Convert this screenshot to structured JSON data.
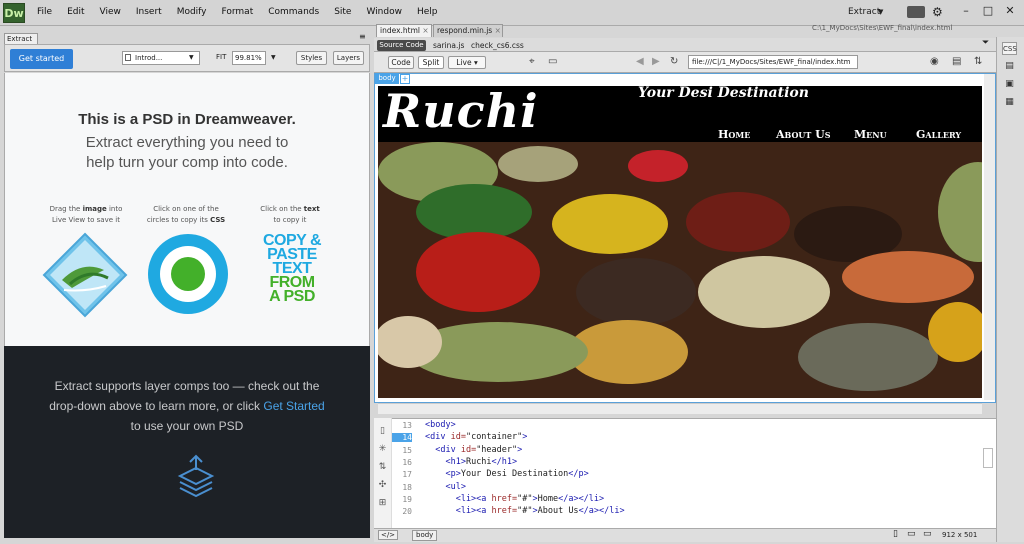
{
  "app": {
    "logo": "Dw",
    "menus": [
      "File",
      "Edit",
      "View",
      "Insert",
      "Modify",
      "Format",
      "Commands",
      "Site",
      "Window",
      "Help"
    ],
    "workspace": "Extract"
  },
  "extract": {
    "tab": "Extract",
    "get_started": "Get started",
    "select_value": "Introd...",
    "fit": "FIT",
    "zoom": "99.81%",
    "styles": "Styles",
    "layers": "Layers",
    "title": "This is a PSD in Dreamweaver.",
    "subtitle_1": "Extract everything you need to",
    "subtitle_2": "help turn your comp into code.",
    "col1_a": "Drag the ",
    "col1_b": "image",
    "col1_c": " into",
    "col1_d": "Live View to save it",
    "col2_a": "Click on one of the",
    "col2_b": "circles to copy its ",
    "col2_c": "CSS",
    "col3_a": "Click on the ",
    "col3_b": "text",
    "col3_c": "to copy it",
    "copy_1": "COPY &",
    "copy_2": "PASTE",
    "copy_3": "TEXT",
    "copy_4": "FROM",
    "copy_5": "A PSD",
    "dark_1": "Extract supports layer comps too — check out the",
    "dark_2a": "drop-down above to learn more, or click ",
    "dark_2b": "Get Started",
    "dark_3": "to use your own PSD",
    "colors": {
      "blue": "#2f7fd6",
      "green": "#43b02a",
      "cyan": "#1fa9e1"
    }
  },
  "document": {
    "tabs": [
      "index.html",
      "respond.min.js"
    ],
    "path": "C:\\1_MyDocs\\Sites\\EWF_final\\index.html",
    "related": {
      "source": "Source Code",
      "files": [
        "sarina.js",
        "check_cs6.css"
      ]
    },
    "views": {
      "code": "Code",
      "split": "Split",
      "live": "Live"
    },
    "url": "file:///C|/1_MyDocs/Sites/EWF_final/index.htm",
    "body_tag": "body",
    "site": {
      "title": "Ruchi",
      "tagline": "Your Desi Destination",
      "nav": [
        "Home",
        "About Us",
        "Menu",
        "Gallery"
      ]
    },
    "code_lines": [
      {
        "n": "13",
        "parts": [
          [
            "t",
            "<body>"
          ]
        ]
      },
      {
        "n": "14",
        "parts": [
          [
            "t",
            "<div "
          ],
          [
            "a",
            "id="
          ],
          [
            "s",
            "\"container\""
          ],
          [
            "t",
            ">"
          ]
        ]
      },
      {
        "n": "15",
        "parts": [
          [
            "t",
            "  <div "
          ],
          [
            "a",
            "id="
          ],
          [
            "s",
            "\"header\""
          ],
          [
            "t",
            ">"
          ]
        ]
      },
      {
        "n": "16",
        "parts": [
          [
            "t",
            "    <h1>"
          ],
          [
            "s",
            "Ruchi"
          ],
          [
            "t",
            "</h1>"
          ]
        ]
      },
      {
        "n": "17",
        "parts": [
          [
            "t",
            "    <p>"
          ],
          [
            "s",
            "Your Desi Destination"
          ],
          [
            "t",
            "</p>"
          ]
        ]
      },
      {
        "n": "18",
        "parts": [
          [
            "t",
            "    <ul>"
          ]
        ]
      },
      {
        "n": "19",
        "parts": [
          [
            "t",
            "      <li><a "
          ],
          [
            "a",
            "href="
          ],
          [
            "s",
            "\"#\""
          ],
          [
            "t",
            ">"
          ],
          [
            "s",
            "Home"
          ],
          [
            "t",
            "</a></li>"
          ]
        ]
      },
      {
        "n": "20",
        "parts": [
          [
            "t",
            "      <li><a "
          ],
          [
            "a",
            "href="
          ],
          [
            "s",
            "\"#\""
          ],
          [
            "t",
            ">"
          ],
          [
            "s",
            "About Us"
          ],
          [
            "t",
            "</a></li>"
          ]
        ]
      }
    ],
    "active_line": "14",
    "status_tag": "body",
    "status_tag_left": "</>",
    "size": "912 x 501"
  }
}
